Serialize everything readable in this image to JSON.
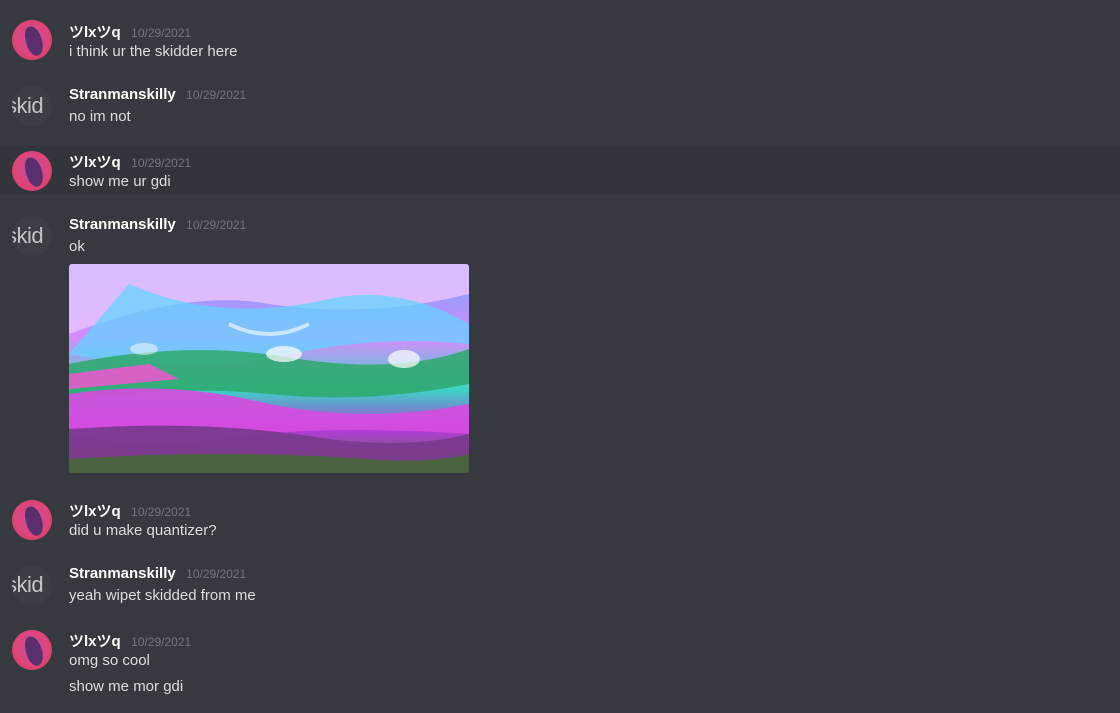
{
  "messages": [
    {
      "author": "ツlxツq",
      "time": "10/29/2021",
      "lines": [
        "i think ur the skidder here"
      ]
    },
    {
      "author": "Stranmanskilly",
      "time": "10/29/2021",
      "lines": [
        "no im not"
      ],
      "avatar_text": "skid"
    },
    {
      "author": "ツlxツq",
      "time": "10/29/2021",
      "lines": [
        "show me ur gdi"
      ]
    },
    {
      "author": "Stranmanskilly",
      "time": "10/29/2021",
      "lines": [
        "ok"
      ],
      "avatar_text": "skid"
    },
    {
      "author": "ツlxツq",
      "time": "10/29/2021",
      "lines": [
        "did u make quantizer?"
      ]
    },
    {
      "author": "Stranmanskilly",
      "time": "10/29/2021",
      "lines": [
        "yeah wipet skidded from me"
      ],
      "avatar_text": "skid"
    },
    {
      "author": "ツlxツq",
      "time": "10/29/2021",
      "lines": [
        "omg so cool",
        "show me mor gdi"
      ]
    }
  ],
  "colors": {
    "background": "#36393f",
    "hover": "#32353b",
    "username": "#ffffff",
    "timestamp": "#72767d",
    "text": "#dcddde"
  },
  "icons": {
    "pink_avatar": "user-avatar-icon",
    "skid_avatar": "user-avatar-icon"
  }
}
